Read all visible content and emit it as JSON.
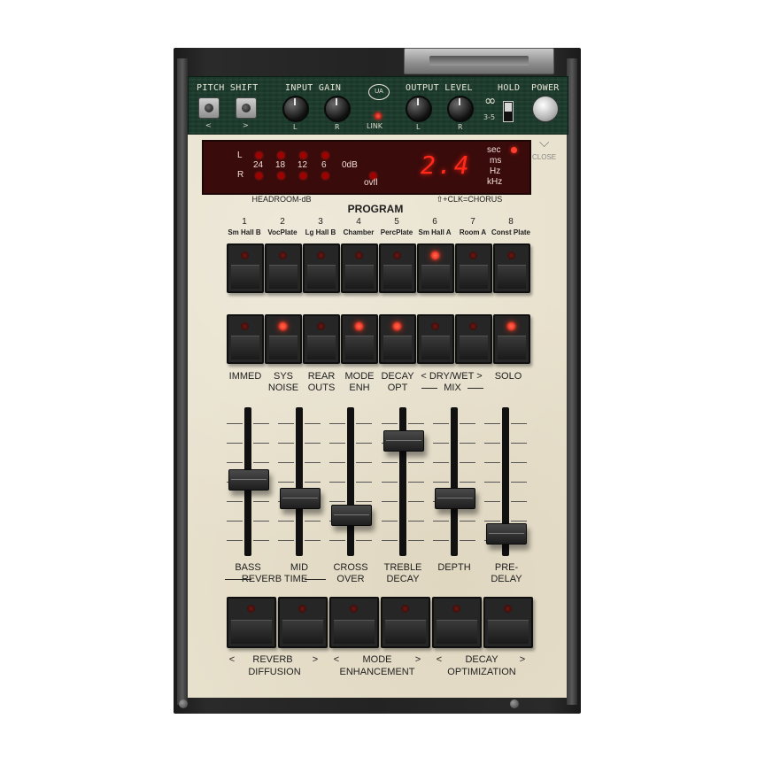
{
  "top": {
    "pitch_shift": "PITCH SHIFT",
    "pitch_down": "<",
    "pitch_up": ">",
    "input_gain": "INPUT GAIN",
    "output_level": "OUTPUT LEVEL",
    "hold": "HOLD",
    "power": "POWER",
    "link": "LINK",
    "left": "L",
    "right": "R",
    "infinity": "∞",
    "hold_range": "3-5",
    "logo": "UA"
  },
  "display": {
    "left_channel": "L",
    "right_channel": "R",
    "meter_scale": [
      "24",
      "18",
      "12",
      "6"
    ],
    "zero_db": "0dB",
    "ovfl": "ovfl",
    "value": "2.4",
    "units": [
      "sec",
      "ms",
      "Hz",
      "kHz"
    ],
    "active_unit": "sec",
    "led_color": "#ff3020"
  },
  "close": {
    "label": "CLOSE",
    "icon": "chevron-down-icon"
  },
  "headroom_label": "HEADROOM-dB",
  "chorus_label": "⇧+CLK=CHORUS",
  "program": {
    "title": "PROGRAM",
    "numbers": [
      "1",
      "2",
      "3",
      "4",
      "5",
      "6",
      "7",
      "8"
    ],
    "names": [
      "Sm Hall B",
      "VocPlate",
      "Lg Hall B",
      "Chamber",
      "PercPlate",
      "Sm Hall A",
      "Room A",
      "Const Plate"
    ],
    "active": [
      false,
      false,
      false,
      false,
      false,
      true,
      false,
      false
    ]
  },
  "modes": {
    "labels_top": [
      "IMMED",
      "SYS",
      "REAR",
      "MODE",
      "DECAY"
    ],
    "labels_bottom": [
      "",
      "NOISE",
      "OUTS",
      "ENH",
      "OPT"
    ],
    "drywet": "< DRY/WET >",
    "mix": "MIX",
    "solo": "SOLO",
    "active": [
      false,
      true,
      false,
      true,
      true,
      false,
      false,
      true
    ]
  },
  "faders": {
    "labels_top": [
      "BASS",
      "MID",
      "CROSS",
      "TREBLE",
      "DEPTH",
      "PRE-"
    ],
    "labels_bottom": [
      "",
      "",
      "OVER",
      "DECAY",
      "",
      "DELAY"
    ],
    "reverb_time": "REVERB TIME",
    "levels": [
      0.52,
      0.38,
      0.25,
      0.82,
      0.38,
      0.1
    ]
  },
  "bottom": {
    "active": [
      false,
      false,
      false,
      false,
      false,
      false
    ],
    "groups": [
      {
        "top": "REVERB",
        "bottom": "DIFFUSION"
      },
      {
        "top": "MODE",
        "bottom": "ENHANCEMENT"
      },
      {
        "top": "DECAY",
        "bottom": "OPTIMIZATION"
      }
    ],
    "arrow_left": "<",
    "arrow_right": ">"
  }
}
